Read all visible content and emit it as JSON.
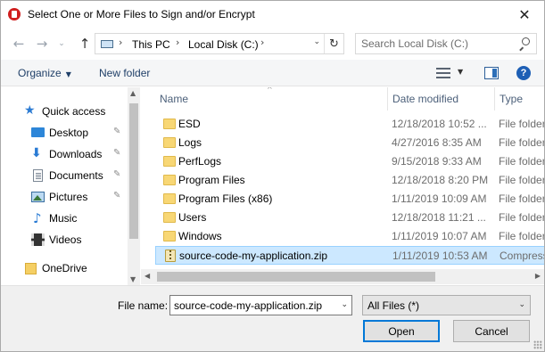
{
  "window": {
    "title": "Select One or More Files to Sign and/or Encrypt",
    "close_glyph": "✕"
  },
  "nav": {
    "back_glyph": "←",
    "forward_glyph": "→",
    "recent_glyph": "⌄",
    "up_glyph": "↑",
    "breadcrumb": [
      "This PC",
      "Local Disk (C:)"
    ],
    "separator_glyph": "›",
    "address_dropdown_glyph": "⌄",
    "refresh_glyph": "↻",
    "search_placeholder": "Search Local Disk (C:)"
  },
  "toolbar": {
    "organize_label": "Organize",
    "caret": "▼",
    "new_folder_label": "New folder",
    "help_glyph": "?"
  },
  "sidebar": {
    "pin_glyph": "✎",
    "items": [
      {
        "label": "Quick access",
        "icon": "star-icon",
        "glyph": "★"
      },
      {
        "label": "Desktop",
        "icon": "desktop-icon"
      },
      {
        "label": "Downloads",
        "icon": "downloads-icon",
        "glyph": "⬇"
      },
      {
        "label": "Documents",
        "icon": "documents-icon"
      },
      {
        "label": "Pictures",
        "icon": "pictures-icon"
      },
      {
        "label": "Music",
        "icon": "music-icon",
        "glyph": "♪"
      },
      {
        "label": "Videos",
        "icon": "videos-icon"
      },
      {
        "label": "OneDrive",
        "icon": "onedrive-icon"
      }
    ]
  },
  "filelist": {
    "sort_glyph": "^",
    "columns": {
      "name": "Name",
      "date": "Date modified",
      "type": "Type"
    },
    "rows": [
      {
        "name": "ESD",
        "date": "12/18/2018 10:52 ...",
        "type": "File folder",
        "kind": "folder"
      },
      {
        "name": "Logs",
        "date": "4/27/2016 8:35 AM",
        "type": "File folder",
        "kind": "folder"
      },
      {
        "name": "PerfLogs",
        "date": "9/15/2018 9:33 AM",
        "type": "File folder",
        "kind": "folder"
      },
      {
        "name": "Program Files",
        "date": "12/18/2018 8:20 PM",
        "type": "File folder",
        "kind": "folder"
      },
      {
        "name": "Program Files (x86)",
        "date": "1/11/2019 10:09 AM",
        "type": "File folder",
        "kind": "folder"
      },
      {
        "name": "Users",
        "date": "12/18/2018 11:21 ...",
        "type": "File folder",
        "kind": "folder"
      },
      {
        "name": "Windows",
        "date": "1/11/2019 10:07 AM",
        "type": "File folder",
        "kind": "folder"
      },
      {
        "name": "source-code-my-application.zip",
        "date": "1/11/2019 10:53 AM",
        "type": "Compress",
        "kind": "zip",
        "selected": true
      }
    ]
  },
  "scroll": {
    "up": "▲",
    "down": "▼",
    "left": "◀",
    "right": "▶"
  },
  "bottom": {
    "file_name_label": "File name:",
    "file_name_value": "source-code-my-application.zip",
    "file_type_value": "All Files  (*)",
    "dropdown_glyph": "⌄",
    "open_label": "Open",
    "cancel_label": "Cancel"
  },
  "colors": {
    "accent": "#0078d7",
    "selection_bg": "#cce8ff",
    "selection_border": "#99d1ff",
    "link": "#1f3f68"
  }
}
